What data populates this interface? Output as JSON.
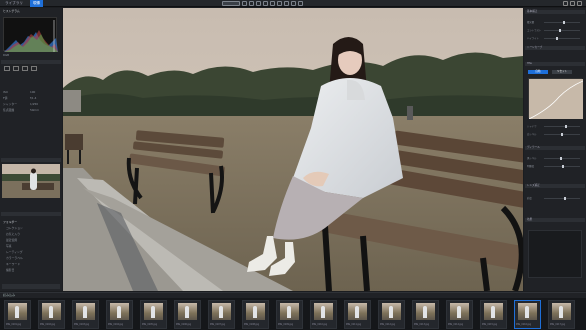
{
  "app": {
    "tabs": [
      {
        "label": "ライブラリ"
      },
      {
        "label": "現像"
      }
    ],
    "view_label": "ファイル"
  },
  "left_panel": {
    "panel_title": "ヒストグラム",
    "histogram_label": "RGB",
    "info_rows": [
      {
        "label": "ISO",
        "value": "100"
      },
      {
        "label": "F値",
        "value": "f/1.4"
      },
      {
        "label": "シャッター",
        "value": "1/250"
      },
      {
        "label": "焦点距離",
        "value": "50mm"
      }
    ],
    "list_items": [
      "フォルダー",
      "コレクション",
      "お気に入り",
      "最近使用",
      "写真",
      "レーティング",
      "カラーラベル",
      "キーワード",
      "撮影日"
    ]
  },
  "right_panel": {
    "sections": [
      "基本補正",
      "トーンカーブ",
      "HSL",
      "ディテール",
      "レンズ補正",
      "効果"
    ],
    "sliders": [
      {
        "label": "露光量",
        "value": 0.55
      },
      {
        "label": "コントラスト",
        "value": 0.45
      },
      {
        "label": "ハイライト",
        "value": 0.35
      },
      {
        "label": "シャドウ",
        "value": 0.62
      },
      {
        "label": "白レベル",
        "value": 0.5
      },
      {
        "label": "黒レベル",
        "value": 0.48
      },
      {
        "label": "明瞭度",
        "value": 0.52
      },
      {
        "label": "彩度",
        "value": 0.58
      }
    ],
    "buttons": [
      "自動",
      "リセット"
    ]
  },
  "filmstrip": {
    "header": "読み込み",
    "thumbs": [
      {
        "label": "IMG_0101.jpg"
      },
      {
        "label": "IMG_0102.jpg"
      },
      {
        "label": "IMG_0103.jpg"
      },
      {
        "label": "IMG_0104.jpg"
      },
      {
        "label": "IMG_0105.jpg"
      },
      {
        "label": "IMG_0106.jpg"
      },
      {
        "label": "IMG_0107.jpg"
      },
      {
        "label": "IMG_0108.jpg"
      },
      {
        "label": "IMG_0109.jpg"
      },
      {
        "label": "IMG_0110.jpg"
      },
      {
        "label": "IMG_0111.jpg"
      },
      {
        "label": "IMG_0112.jpg"
      },
      {
        "label": "IMG_0113.jpg"
      },
      {
        "label": "IMG_0114.jpg"
      },
      {
        "label": "IMG_0115.jpg"
      },
      {
        "label": "IMG_0116.jpg"
      },
      {
        "label": "IMG_0117.jpg"
      }
    ]
  },
  "colors": {
    "accent": "#1e6fd9",
    "panel": "#202226",
    "bg": "#1b1d20"
  }
}
